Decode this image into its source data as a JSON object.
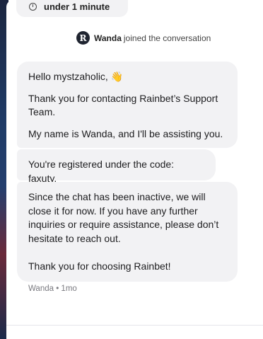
{
  "conversation": {
    "reply_time_label": "under 1 minute",
    "join_event": {
      "agent_name": "Wanda",
      "text": "joined the conversation",
      "avatar_letter": "R"
    },
    "messages": [
      {
        "lines": [
          "Hello mystzaholic, 👋",
          "Thank you for contacting Rainbet’s Support Team.",
          "My name is Wanda, and I'll be assisting you."
        ]
      },
      {
        "lines": [
          "You're registered under the code: faxuty."
        ]
      },
      {
        "lines": [
          "Since the chat has been inactive, we will close it for now. If you have any further inquiries or require assistance, please don’t hesitate to reach out.",
          "Thank you for choosing Rainbet!"
        ]
      }
    ],
    "meta": "Wanda • 1mo"
  }
}
